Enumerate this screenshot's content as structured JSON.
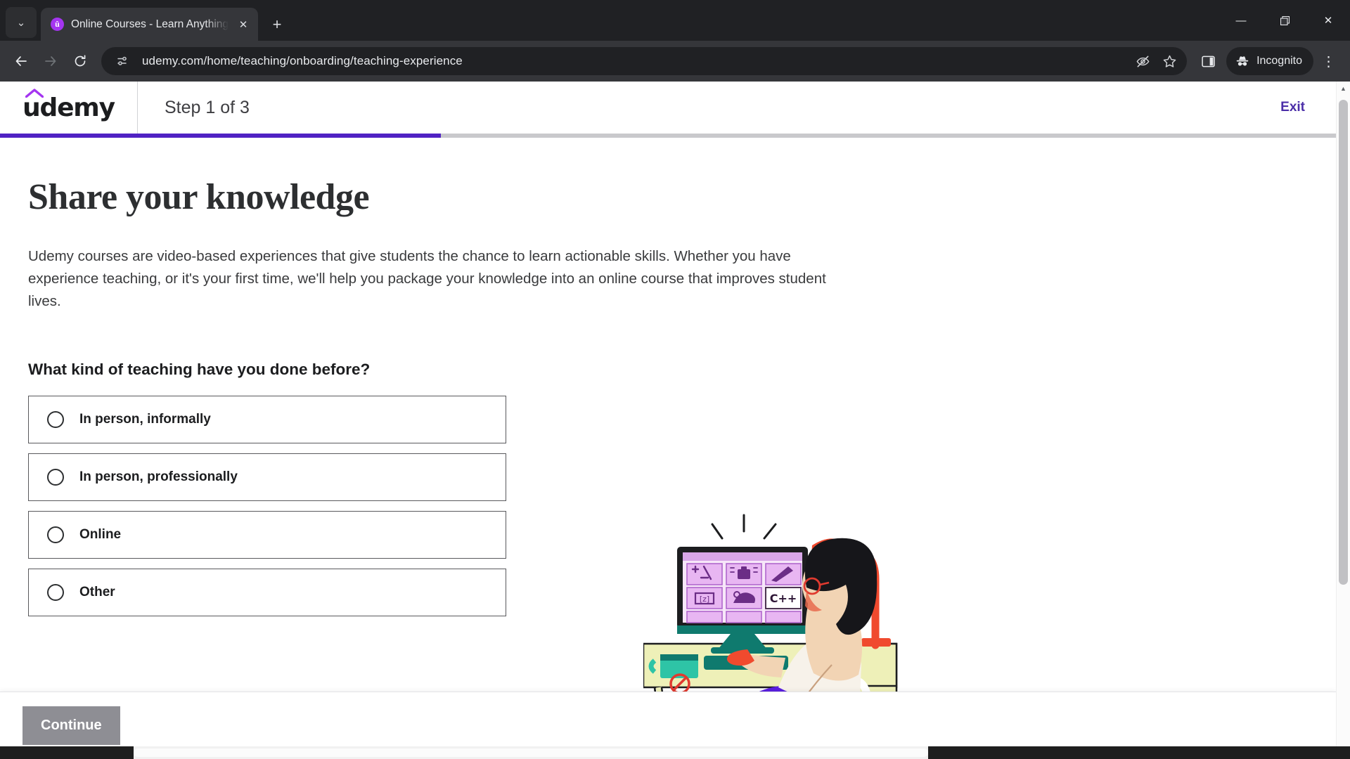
{
  "browser": {
    "tab": {
      "favicon_icon": "udemy-favicon",
      "title": "Online Courses - Learn Anything",
      "close_icon": "✕"
    },
    "tabstrip_dropdown_icon": "⌄",
    "new_tab_icon": "+",
    "window_controls": {
      "minimize": "—",
      "maximize": "❐",
      "close": "✕"
    },
    "nav": {
      "back_icon": "←",
      "forward_icon": "→",
      "reload_icon": "⟳"
    },
    "omnibox": {
      "site_info_icon": "tune-icon",
      "url": "udemy.com/home/teaching/onboarding/teaching-experience",
      "tracking_protection_icon": "eye-slash-icon",
      "bookmark_icon": "star-icon"
    },
    "side_panel_icon": "side-panel-icon",
    "incognito": {
      "label": "Incognito",
      "icon": "incognito-hat-icon"
    },
    "menu_icon": "⋮"
  },
  "header": {
    "logo_text": "udemy",
    "step_label": "Step 1 of 3",
    "exit_label": "Exit",
    "progress_percent": 33,
    "progress_color": "#5022c3",
    "track_color": "#c9c9cc"
  },
  "main": {
    "title": "Share your knowledge",
    "intro": "Udemy courses are video-based experiences that give students the chance to learn actionable skills. Whether you have experience teaching, or it's your first time, we'll help you package your knowledge into an online course that improves student lives.",
    "question": "What kind of teaching have you done before?",
    "options": [
      {
        "label": "In person, informally",
        "selected": false
      },
      {
        "label": "In person, professionally",
        "selected": false
      },
      {
        "label": "Online",
        "selected": false
      },
      {
        "label": "Other",
        "selected": false
      }
    ],
    "illustration_name": "woman-at-desk-computer-illustration",
    "illustration_screen_tiles": [
      "+/-",
      "camera",
      "pencil",
      "code-brackets",
      "palette",
      "C++"
    ]
  },
  "footer": {
    "continue_label": "Continue",
    "continue_enabled": false,
    "continue_color": "#8e8e94"
  },
  "colors": {
    "brand_purple": "#a435f0",
    "progress_purple": "#5022c3",
    "exit_purple": "#4b2ea8",
    "text_dark": "#1c1d1f"
  }
}
